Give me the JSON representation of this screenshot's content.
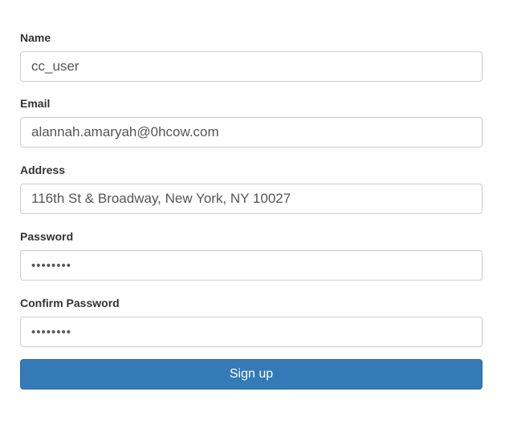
{
  "form": {
    "name": {
      "label": "Name",
      "value": "cc_user"
    },
    "email": {
      "label": "Email",
      "value": "alannah.amaryah@0hcow.com"
    },
    "address": {
      "label": "Address",
      "value": "116th St & Broadway, New York, NY 10027"
    },
    "password": {
      "label": "Password",
      "value": "••••••••"
    },
    "confirm_password": {
      "label": "Confirm Password",
      "value": "••••••••"
    },
    "submit_label": "Sign up"
  },
  "colors": {
    "primary_button": "#337ab7",
    "input_border": "#cccccc",
    "label_text": "#333333"
  }
}
